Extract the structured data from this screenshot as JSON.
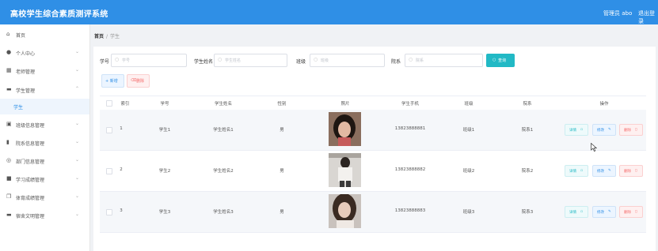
{
  "header": {
    "title": "高校学生综合素质测评系统",
    "user": "管理员 abo",
    "logout": "退出登录"
  },
  "sidebar": {
    "items": [
      {
        "label": "首页",
        "icon": "home-icon"
      },
      {
        "label": "个人中心",
        "icon": "person-icon"
      },
      {
        "label": "老师管理",
        "icon": "grid-icon"
      },
      {
        "label": "学生管理",
        "icon": "student-icon",
        "sub": "学生"
      },
      {
        "label": "班级信息管理",
        "icon": "clipboard-icon"
      },
      {
        "label": "院系信息管理",
        "icon": "bar-chart-icon"
      },
      {
        "label": "部门信息管理",
        "icon": "circle-icon"
      },
      {
        "label": "学习成绩管理",
        "icon": "apps-icon"
      },
      {
        "label": "体育成绩管理",
        "icon": "copy-icon"
      },
      {
        "label": "宿舍文明管理",
        "icon": "card-icon"
      }
    ]
  },
  "breadcrumb": {
    "home": "首页",
    "sep": "/",
    "current": "学生"
  },
  "search": {
    "fields": [
      {
        "label": "学号",
        "placeholder": "学号"
      },
      {
        "label": "学生姓名",
        "placeholder": "学生姓名"
      },
      {
        "label": "班级",
        "placeholder": "班级"
      },
      {
        "label": "院系",
        "placeholder": "院系"
      }
    ],
    "query_label": "查询"
  },
  "toolbar": {
    "add_label": "+ 新增",
    "delete_label": "删除"
  },
  "table": {
    "columns": [
      "索引",
      "学号",
      "学生姓名",
      "性别",
      "照片",
      "学生手机",
      "班级",
      "院系",
      "操作"
    ],
    "rows": [
      {
        "index": "1",
        "student_id": "学生1",
        "name": "学生姓名1",
        "gender": "男",
        "phone": "13823888881",
        "class": "班级1",
        "dept": "院系1"
      },
      {
        "index": "2",
        "student_id": "学生2",
        "name": "学生姓名2",
        "gender": "男",
        "phone": "13823888882",
        "class": "班级2",
        "dept": "院系2"
      },
      {
        "index": "3",
        "student_id": "学生3",
        "name": "学生姓名3",
        "gender": "男",
        "phone": "13823888883",
        "class": "班级3",
        "dept": "院系3"
      }
    ],
    "actions": {
      "view": "详情",
      "edit": "修改",
      "delete": "删除"
    }
  },
  "colors": {
    "primary": "#2f8fe6",
    "teal": "#22b9c5",
    "danger": "#f56c6c"
  }
}
